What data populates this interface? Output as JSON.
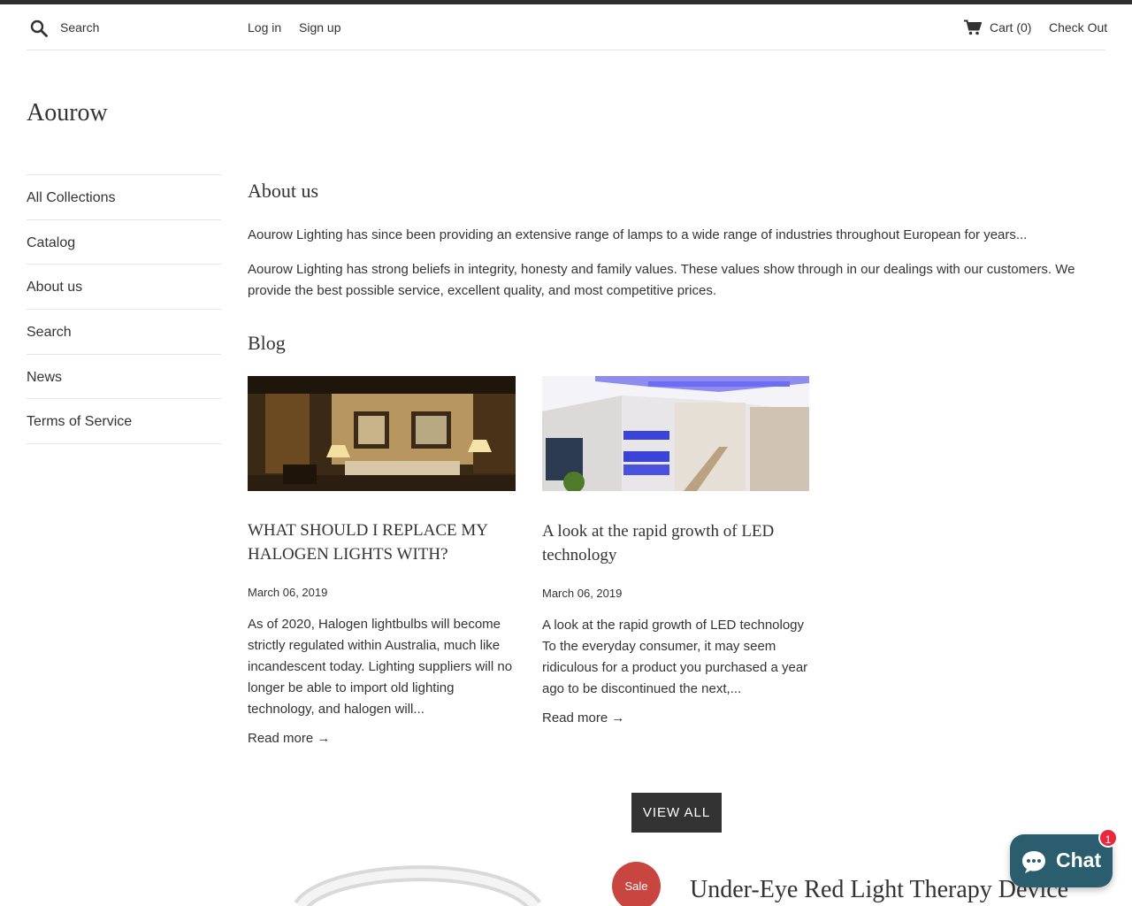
{
  "header": {
    "search_placeholder": "Search",
    "login": "Log in",
    "signup": "Sign up",
    "cart": "Cart (0)",
    "checkout": "Check Out"
  },
  "brand": "Aourow",
  "sidebar": {
    "items": [
      {
        "label": "All Collections"
      },
      {
        "label": "Catalog"
      },
      {
        "label": "About us"
      },
      {
        "label": "Search"
      },
      {
        "label": "News"
      },
      {
        "label": "Terms of Service"
      }
    ]
  },
  "about": {
    "title": "About us",
    "p1": "Aourow Lighting has since been providing an extensive range of lamps to a wide range of industries throughout European for years...",
    "p2": "Aourow Lighting has strong beliefs in integrity, honesty and family values. These values show through in our dealings with our customers. We provide the best possible service, excellent quality, and most competitive prices."
  },
  "blog": {
    "title": "Blog",
    "posts": [
      {
        "title": "WHAT SHOULD I REPLACE MY HALOGEN LIGHTS WITH?",
        "date": "March 06, 2019",
        "excerpt": "As of 2020, Halogen lightbulbs will become strictly regulated within Australia, much like incandescent today. Lighting suppliers will no longer be able to import old lighting technology, and halogen will...",
        "read_more": "Read more →"
      },
      {
        "title": "A look at the rapid growth of LED technology",
        "date": "March 06, 2019",
        "excerpt": "A look at the rapid growth of LED technology To the everyday consumer, it may seem ridiculous for a product you purchased a year ago to be discontinued the next,...",
        "read_more": "Read more →"
      }
    ],
    "view_all": "VIEW ALL"
  },
  "product": {
    "badge": "Sale",
    "title": "Under-Eye Red Light Therapy Device"
  },
  "chat": {
    "label": "Chat",
    "notification_count": "1"
  },
  "colors": {
    "text": "#333333",
    "button": "#333333",
    "sale": "#c94540",
    "chat": "#2a5d6e",
    "badge": "#e8283e"
  }
}
